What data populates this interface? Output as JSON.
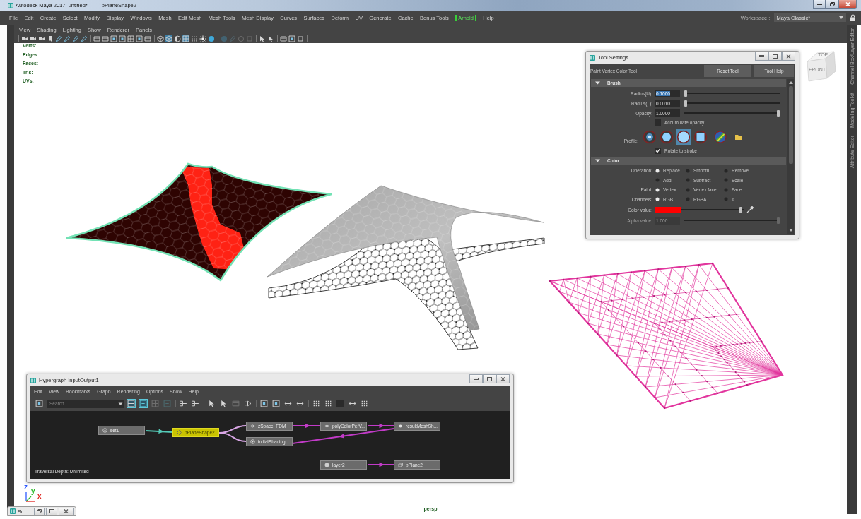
{
  "window": {
    "title": "Autodesk Maya 2017: untitled*   ---   pPlaneShape2"
  },
  "menu_bar": {
    "items": [
      {
        "label": "File",
        "kind": "menu"
      },
      {
        "label": "Edit",
        "kind": "menu"
      },
      {
        "label": "Create",
        "kind": "menu"
      },
      {
        "label": "Select",
        "kind": "menu"
      },
      {
        "label": "Modify",
        "kind": "menu"
      },
      {
        "label": "Display",
        "kind": "menu"
      },
      {
        "label": "Windows",
        "kind": "menu"
      },
      {
        "label": "Mesh",
        "kind": "menu"
      },
      {
        "label": "Edit Mesh",
        "kind": "menu"
      },
      {
        "label": "Mesh Tools",
        "kind": "menu"
      },
      {
        "label": "Mesh Display",
        "kind": "menu"
      },
      {
        "label": "Curves",
        "kind": "menu"
      },
      {
        "label": "Surfaces",
        "kind": "menu"
      },
      {
        "label": "Deform",
        "kind": "menu"
      },
      {
        "label": "UV",
        "kind": "menu"
      },
      {
        "label": "Generate",
        "kind": "menu"
      },
      {
        "label": "Cache",
        "kind": "menu"
      },
      {
        "label": "Bonus Tools",
        "kind": "menu"
      },
      {
        "label": "Arnold",
        "kind": "plugin"
      },
      {
        "label": "Help",
        "kind": "menu"
      }
    ]
  },
  "workspace": {
    "label": "Workspace :",
    "value": "Maya Classic*"
  },
  "viewport": {
    "menu": [
      "View",
      "Shading",
      "Lighting",
      "Show",
      "Renderer",
      "Panels"
    ],
    "toolbar": [
      {
        "selected": false,
        "disabled": false
      },
      {
        "selected": false,
        "disabled": false
      },
      {
        "selected": false,
        "disabled": false
      },
      {
        "selected": false,
        "disabled": false
      },
      {
        "selected": false,
        "disabled": false
      },
      {
        "selected": false,
        "disabled": false
      },
      {
        "selected": false,
        "disabled": false
      },
      {
        "selected": false,
        "disabled": false
      },
      {
        "selected": false,
        "disabled": false
      },
      {
        "selected": false,
        "disabled": false
      },
      {
        "selected": false,
        "disabled": false
      },
      {
        "selected": false,
        "disabled": false
      },
      {
        "selected": false,
        "disabled": false
      },
      {
        "selected": false,
        "disabled": false
      },
      {
        "selected": false,
        "disabled": false
      },
      {
        "selected": false,
        "disabled": false
      },
      {
        "selected": true,
        "disabled": false
      },
      {
        "selected": false,
        "disabled": false
      },
      {
        "selected": true,
        "disabled": false
      },
      {
        "selected": false,
        "disabled": false
      },
      {
        "selected": false,
        "disabled": false
      },
      {
        "selected": false,
        "disabled": false
      },
      {
        "selected": false,
        "disabled": true
      },
      {
        "selected": false,
        "disabled": true
      },
      {
        "selected": false,
        "disabled": true
      },
      {
        "selected": false,
        "disabled": true
      },
      {
        "selected": false,
        "disabled": false
      },
      {
        "selected": false,
        "disabled": false
      },
      {
        "selected": false,
        "disabled": false
      },
      {
        "selected": false,
        "disabled": false
      },
      {
        "selected": false,
        "disabled": false
      }
    ],
    "hud": [
      "Verts:",
      "Edges:",
      "Faces:",
      "Tris:",
      "UVs:"
    ],
    "view_cube": {
      "top": "TOP",
      "front": "FRONT"
    },
    "axes": [
      {
        "label": "z",
        "color": "#2f5bff"
      },
      {
        "label": "y",
        "color": "#2dbb2d"
      },
      {
        "label": "x",
        "color": "#e0231f"
      }
    ],
    "camera": "persp"
  },
  "side_tabs": [
    "Channel Box/Layer Editor",
    "Modeling Toolkit",
    "Attribute Editor"
  ],
  "tool_settings": {
    "title": "Tool Settings",
    "tool": "Paint Vertex Color Tool",
    "buttons": [
      "Reset Tool",
      "Tool Help"
    ],
    "sections": [
      {
        "title": "Brush",
        "expanded": true,
        "rows": [
          {
            "kind": "slider",
            "label": "Radius(U):",
            "value": "0.1000",
            "text_selected": true,
            "disabled": false,
            "level": 0.01
          },
          {
            "kind": "slider",
            "label": "Radius(L):",
            "value": "0.0010",
            "text_selected": false,
            "disabled": false,
            "level": 0.01
          },
          {
            "kind": "slider",
            "label": "Opacity:",
            "value": "1.0000",
            "text_selected": false,
            "disabled": false,
            "level": 1
          },
          {
            "kind": "checkbox",
            "label": "Accumulate opacity",
            "checked": false
          },
          {
            "kind": "profile",
            "label": "Profile:",
            "options": [
              {
                "selected": false
              },
              {
                "selected": false
              },
              {
                "selected": true
              },
              {
                "selected": false
              }
            ]
          },
          {
            "kind": "checkbox",
            "label": "Rotate to stroke",
            "checked": true
          }
        ]
      },
      {
        "title": "Color",
        "expanded": true,
        "rows": [
          {
            "kind": "radio",
            "label": "Operation:",
            "options": [
              {
                "label": "Replace",
                "selected": true,
                "disabled": false
              },
              {
                "label": "Smooth",
                "selected": false,
                "disabled": false
              },
              {
                "label": "Remove",
                "selected": false,
                "disabled": false
              },
              {
                "label": "Add",
                "selected": false,
                "disabled": false
              },
              {
                "label": "Subtract",
                "selected": false,
                "disabled": false
              },
              {
                "label": "Scale",
                "selected": false,
                "disabled": false
              }
            ]
          },
          {
            "kind": "radio",
            "label": "Paint:",
            "options": [
              {
                "label": "Vertex",
                "selected": true,
                "disabled": false
              },
              {
                "label": "Vertex face",
                "selected": false,
                "disabled": false
              },
              {
                "label": "Face",
                "selected": false,
                "disabled": false
              }
            ]
          },
          {
            "kind": "radio",
            "label": "Channels:",
            "options": [
              {
                "label": "RGB",
                "selected": true,
                "disabled": false
              },
              {
                "label": "RGBA",
                "selected": false,
                "disabled": false
              },
              {
                "label": "A",
                "selected": false,
                "disabled": true
              }
            ]
          },
          {
            "kind": "color",
            "label": "Color value:",
            "color": "#ff0000",
            "level": 0.98
          },
          {
            "kind": "slider",
            "label": "Alpha value:",
            "value": "1.000",
            "text_selected": false,
            "disabled": true,
            "level": 1
          }
        ]
      }
    ]
  },
  "hypergraph": {
    "title": "Hypergraph InputOutput1",
    "menu": [
      "Edit",
      "View",
      "Bookmarks",
      "Graph",
      "Rendering",
      "Options",
      "Show",
      "Help"
    ],
    "search": {
      "placeholder": "Search..."
    },
    "toolbar": [
      {
        "selected": false,
        "disabled": false
      },
      {
        "selected": true,
        "disabled": false
      },
      {
        "selected": true,
        "disabled": false
      },
      {
        "selected": false,
        "disabled": true
      },
      {
        "selected": false,
        "disabled": true
      },
      {
        "selected": false,
        "disabled": false
      },
      {
        "selected": false,
        "disabled": false
      },
      {
        "selected": false,
        "disabled": false
      },
      {
        "selected": false,
        "disabled": false
      },
      {
        "selected": false,
        "disabled": true
      },
      {
        "selected": false,
        "disabled": false
      },
      {
        "selected": false,
        "disabled": false
      },
      {
        "selected": false,
        "disabled": false
      },
      {
        "selected": false,
        "disabled": false
      },
      {
        "selected": false,
        "disabled": false
      },
      {
        "selected": false,
        "disabled": false
      },
      {
        "selected": false,
        "disabled": false
      },
      {
        "selected": false,
        "disabled": false
      },
      {
        "selected": false,
        "disabled": false
      },
      {
        "selected": false,
        "disabled": false
      }
    ],
    "nodes": [
      {
        "label": "set1",
        "selected": false
      },
      {
        "label": "pPlaneShape2",
        "selected": true
      },
      {
        "label": "zSpace_FDM",
        "selected": false
      },
      {
        "label": "initialShading...",
        "selected": false
      },
      {
        "label": "polyColorPerV...",
        "selected": false
      },
      {
        "label": "resultMeshSh...",
        "selected": false
      },
      {
        "label": "layer2",
        "selected": false
      },
      {
        "label": "pPlane2",
        "selected": false
      }
    ],
    "edges": [
      {
        "color": "#55cbb8"
      },
      {
        "color": "#d9a6e6"
      },
      {
        "color": "#d9a6e6"
      },
      {
        "color": "#c23bc8"
      },
      {
        "color": "#c23bc8"
      },
      {
        "color": "#c23bc8"
      },
      {
        "color": "#c23bc8"
      }
    ],
    "status": "Traversal Depth: Unlimited"
  },
  "minimized_window": {
    "title": "Sc.."
  }
}
